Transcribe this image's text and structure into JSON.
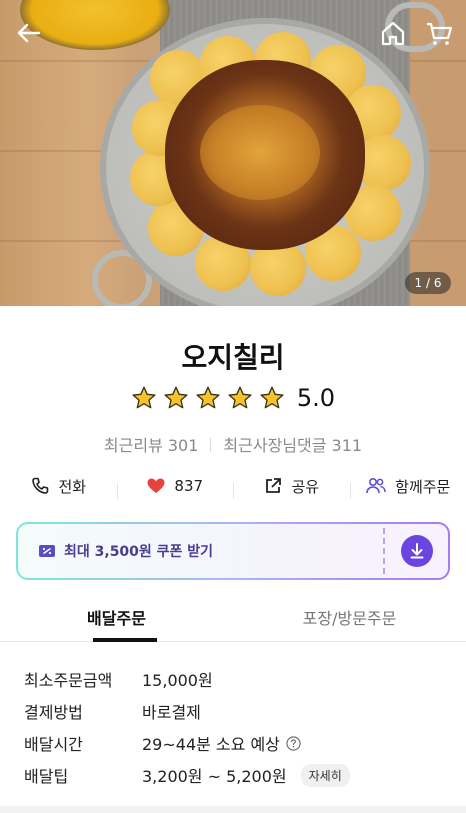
{
  "hero": {
    "image_counter": "1 / 6",
    "back_icon": "back-arrow-icon",
    "home_icon": "home-icon",
    "cart_icon": "cart-icon"
  },
  "store": {
    "name": "오지칠리",
    "rating": "5.0",
    "rating_stars": 5,
    "reviews_label": "최근리뷰 301",
    "owner_replies_label": "최근사장님댓글 311"
  },
  "actions": [
    {
      "icon": "phone-icon",
      "label": "전화"
    },
    {
      "icon": "heart-icon",
      "label": "837"
    },
    {
      "icon": "share-icon",
      "label": "공유"
    },
    {
      "icon": "group-order-icon",
      "label": "함께주문"
    }
  ],
  "coupon": {
    "label": "최대 3,500원 쿠폰 받기",
    "icon": "coupon-icon",
    "download_icon": "download-icon"
  },
  "tabs": [
    {
      "label": "배달주문",
      "active": true
    },
    {
      "label": "포장/방문주문",
      "active": false
    }
  ],
  "info": {
    "min_order": {
      "label": "최소주문금액",
      "value": "15,000원"
    },
    "payment": {
      "label": "결제방법",
      "value": "바로결제"
    },
    "delivery_time": {
      "label": "배달시간",
      "value": "29~44분 소요 예상"
    },
    "delivery_tip": {
      "label": "배달팁",
      "value": "3,200원 ~ 5,200원",
      "detail_button": "자세히"
    }
  },
  "colors": {
    "accent_purple": "#6b45e0",
    "star_yellow": "#f5c32c",
    "heart_red": "#e8423f"
  }
}
